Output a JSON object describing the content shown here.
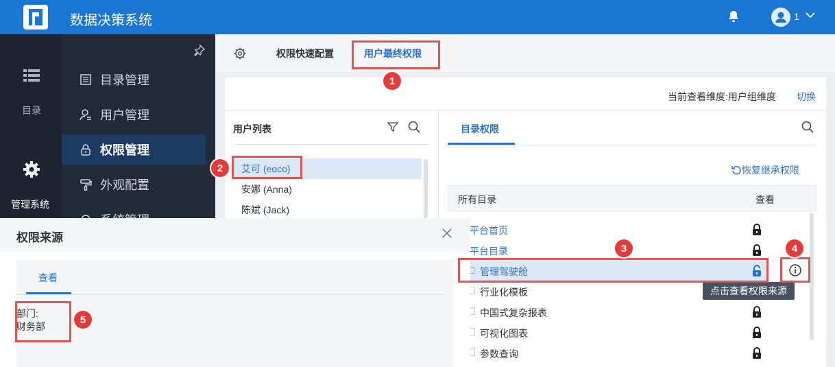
{
  "app": {
    "title": "数据决策系统",
    "user_label": "1"
  },
  "rail": {
    "directory": "目录",
    "admin": "管理系统"
  },
  "menu": {
    "items": [
      {
        "label": "目录管理"
      },
      {
        "label": "用户管理"
      },
      {
        "label": "权限管理"
      },
      {
        "label": "外观配置"
      },
      {
        "label": "系统管理"
      }
    ]
  },
  "tabs": {
    "quick_config": "权限快速配置",
    "final_permission": "用户最终权限"
  },
  "toolbar": {
    "dimension": "当前查看维度:用户组维度",
    "switch": "切换"
  },
  "user_list": {
    "title": "用户列表",
    "users": [
      "艾可 (eoco)",
      "安娜 (Anna)",
      "陈斌 (Jack)"
    ]
  },
  "dir_perm": {
    "tab": "目录权限",
    "restore": "恢复继承权限",
    "col_all": "所有目录",
    "col_view": "查看",
    "rows": [
      {
        "name": "平台首页"
      },
      {
        "name": "平台目录"
      },
      {
        "name": "管理驾驶舱"
      },
      {
        "name": "行业化模板"
      },
      {
        "name": "中国式复杂报表"
      },
      {
        "name": "可视化图表"
      },
      {
        "name": "参数查询"
      }
    ],
    "tooltip": "点击查看权限来源"
  },
  "dialog": {
    "title": "权限来源",
    "tab": "查看",
    "source_type": "部门:",
    "source_value": "财务部"
  },
  "callouts": [
    "1",
    "2",
    "3",
    "4",
    "5"
  ],
  "colors": {
    "header": "#1976d2",
    "accent": "#2f6fd0",
    "callout": "#e05454"
  }
}
